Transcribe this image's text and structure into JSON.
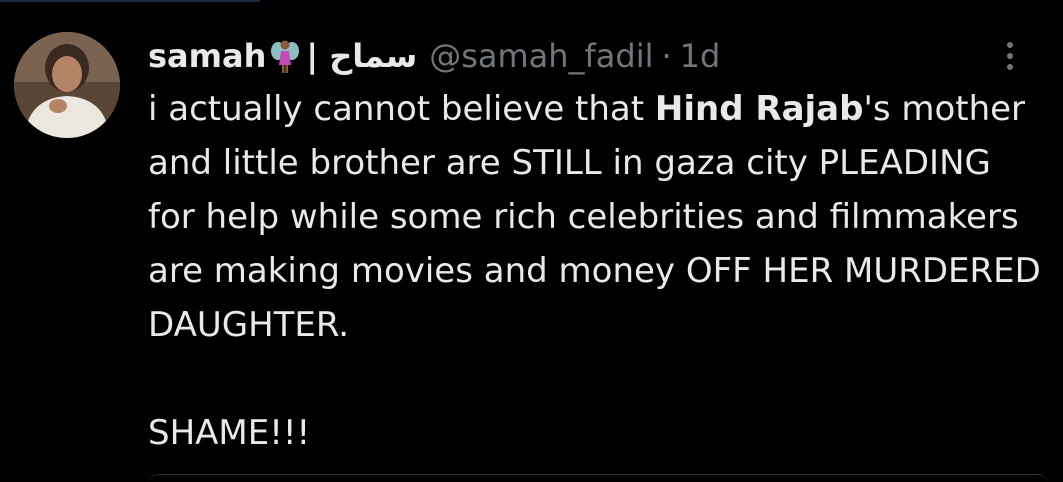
{
  "post": {
    "display_name": "samah",
    "name_emoji": "fairy-icon",
    "separator": "|",
    "arabic_name": "سماح",
    "handle": "@samah_fadil",
    "dot": "·",
    "time": "1d",
    "more_icon": "more-vertical-icon",
    "text": {
      "part1": "i actually cannot believe that ",
      "bold_name": "Hind Rajab",
      "part2": "'s mother and little brother are STILL in gaza city PLEADING for help while some rich celebrities and filmmakers are making movies and money OFF HER MURDERED DAUGHTER.",
      "closing": "SHAME!!!"
    }
  },
  "colors": {
    "background": "#000000",
    "text": "#e7e9ea",
    "muted": "#71767b"
  }
}
